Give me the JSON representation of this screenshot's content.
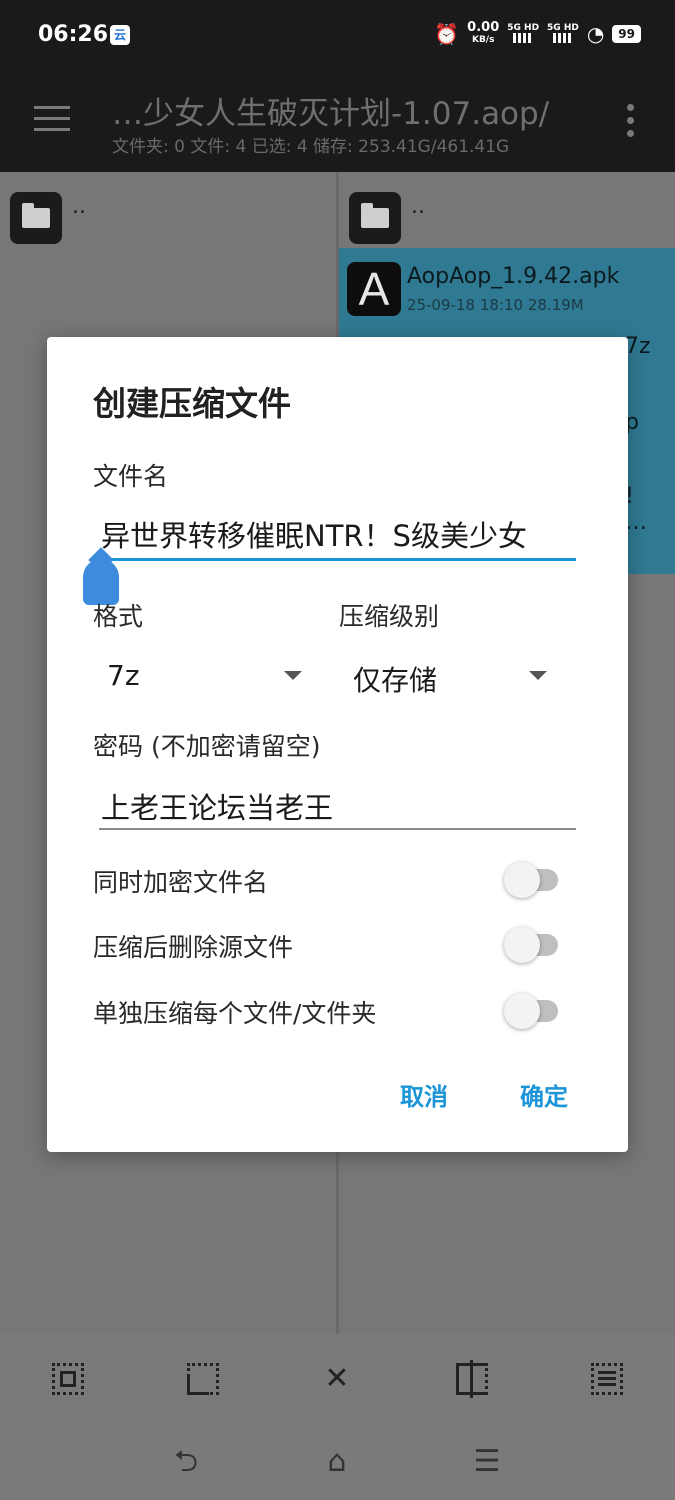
{
  "status_bar": {
    "time": "06:26",
    "app_badge": "云",
    "speed_value": "0.00",
    "speed_unit": "KB/s",
    "sig1": "5G HD",
    "sig2": "5G HD",
    "battery": "99"
  },
  "app_bar": {
    "title": "…少女人生破灭计划-1.07.aop/",
    "subtitle": "文件夹: 0  文件: 4  已选: 4  储存: 253.41G/461.41G"
  },
  "left_pane": {
    "up_label": ".."
  },
  "right_pane": {
    "up_label": "..",
    "files": [
      {
        "icon_letter": "A",
        "name": "AopAop_1.9.42.apk",
        "meta": "25-09-18 18:10  28.19M"
      }
    ],
    "peek_texts": [
      "7z",
      "p",
      "!",
      "…"
    ]
  },
  "dialog": {
    "title": "创建压缩文件",
    "filename_label": "文件名",
    "filename_value": "异世界转移催眠NTR！S级美少女",
    "format_label": "格式",
    "format_value": "7z",
    "level_label": "压缩级别",
    "level_value": "仅存储",
    "password_label": "密码 (不加密请留空)",
    "password_value": "上老王论坛当老王",
    "opt_encrypt_names": "同时加密文件名",
    "opt_delete_source": "压缩后删除源文件",
    "opt_separate": "单独压缩每个文件/文件夹",
    "cancel": "取消",
    "ok": "确定",
    "accent_color": "#1b95d8"
  },
  "toolbar": {
    "icons": [
      "select-all-icon",
      "select-range-icon",
      "close-icon",
      "split-pane-icon",
      "list-icon"
    ],
    "close_glyph": "✕"
  },
  "navbar": {
    "back_glyph": "⮌",
    "home_glyph": "⌂",
    "menu_glyph": "☰"
  }
}
